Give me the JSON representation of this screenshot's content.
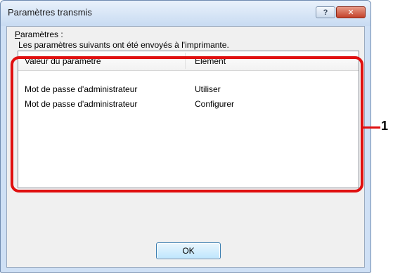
{
  "window": {
    "title": "Paramètres transmis",
    "help_label": "?",
    "close_label": "✕"
  },
  "intro_text": "Les paramètres suivants ont été envoyés à l'imprimante.",
  "group_label": {
    "accel": "P",
    "rest": "aramètres :"
  },
  "table": {
    "columns": [
      "Valeur du paramètre",
      "Elément"
    ],
    "rows": [
      [
        "Mot de passe d'administrateur",
        "Utiliser"
      ],
      [
        "Mot de passe d'administrateur",
        "Configurer"
      ]
    ]
  },
  "ok_label": "OK",
  "callout_number": "1",
  "colors": {
    "callout": "#e01010",
    "close_button": "#c3422b"
  },
  "icons": {
    "help": "question-mark-icon",
    "close": "close-icon"
  }
}
